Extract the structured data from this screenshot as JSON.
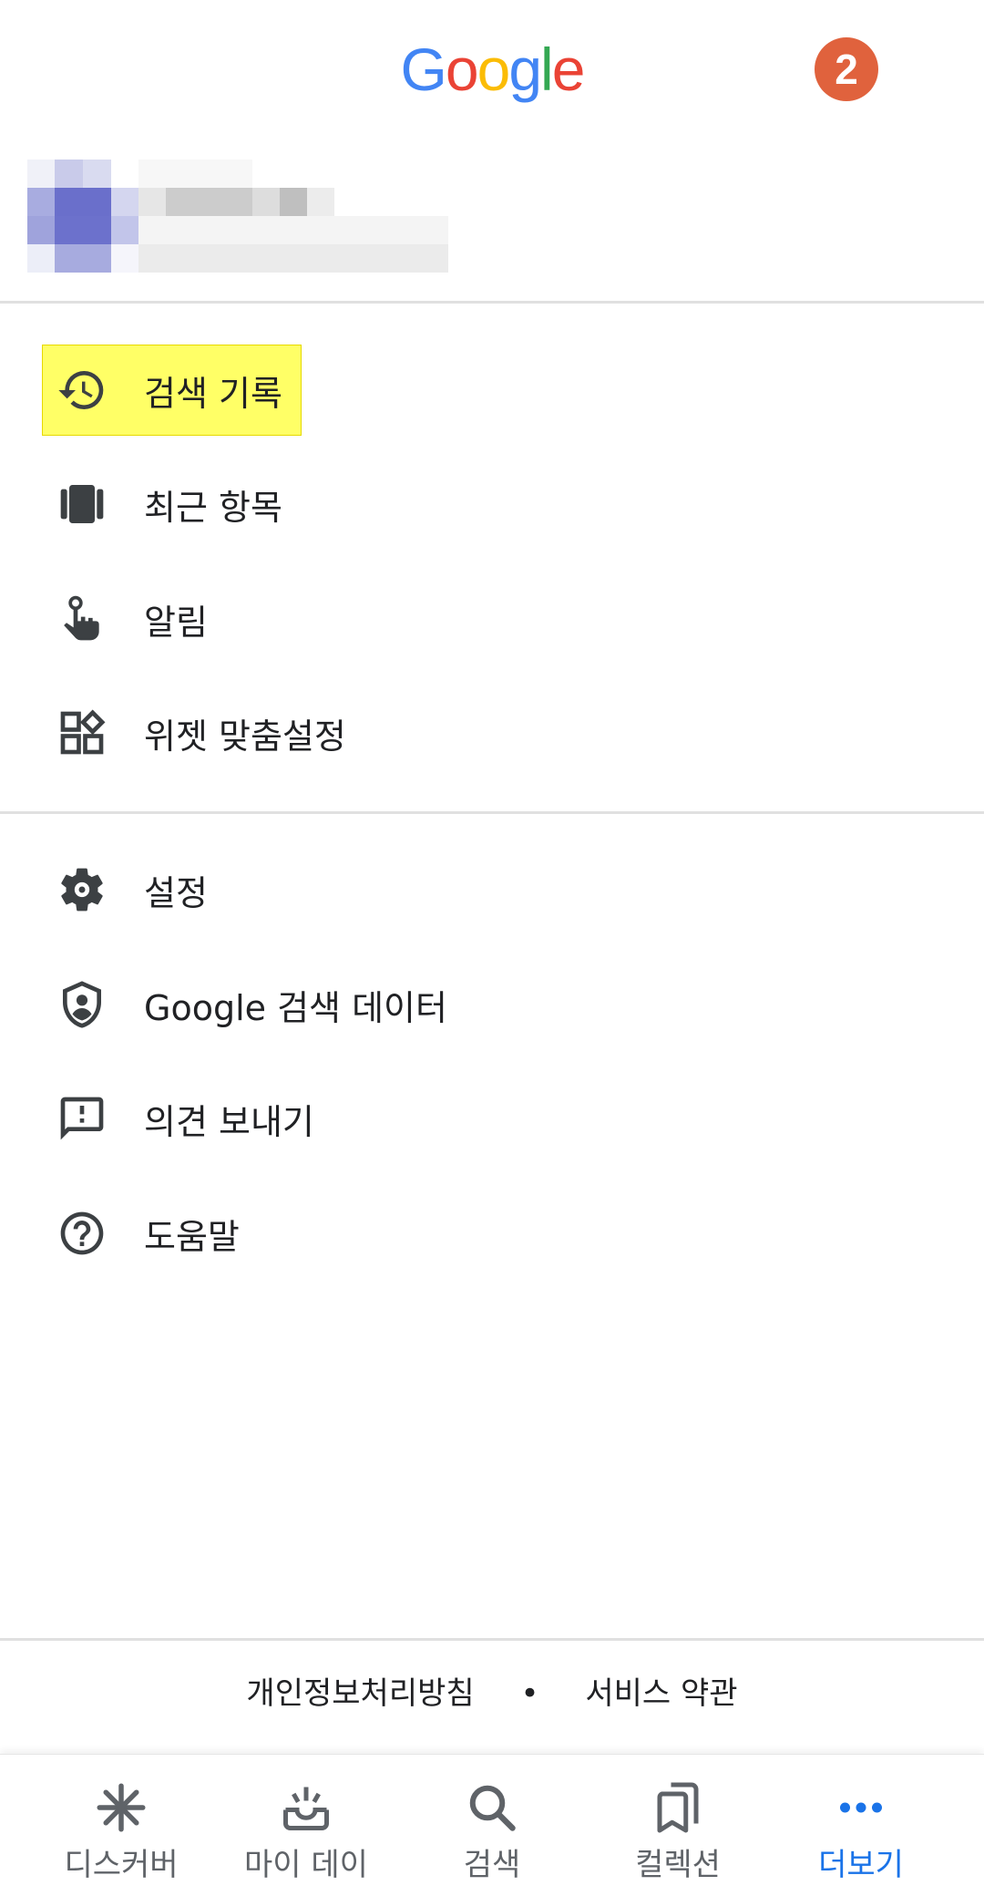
{
  "header": {
    "logo_letters": [
      "G",
      "o",
      "o",
      "g",
      "l",
      "e"
    ],
    "logo_colors": [
      "#4285F4",
      "#EA4335",
      "#FBBC05",
      "#4285F4",
      "#34A853",
      "#EA4335"
    ],
    "notification_count": "2",
    "badge_color": "#e0623d"
  },
  "menu": {
    "items": [
      {
        "label": "검색 기록",
        "icon": "history-icon",
        "highlighted": true
      },
      {
        "label": "최근 항목",
        "icon": "recent-cards-icon"
      },
      {
        "label": "알림",
        "icon": "reminder-hand-icon"
      },
      {
        "label": "위젯 맞춤설정",
        "icon": "widgets-icon"
      },
      {
        "label": "설정",
        "icon": "gear-icon"
      },
      {
        "label": "Google 검색 데이터",
        "icon": "shield-account-icon"
      },
      {
        "label": "의견 보내기",
        "icon": "feedback-icon"
      },
      {
        "label": "도움말",
        "icon": "help-circle-icon"
      }
    ],
    "highlight_color": "#ffff66"
  },
  "footer": {
    "privacy": "개인정보처리방침",
    "separator": "•",
    "terms": "서비스 약관"
  },
  "bottom_nav": {
    "items": [
      {
        "label": "디스커버",
        "icon": "asterisk-icon"
      },
      {
        "label": "마이 데이",
        "icon": "inbox-sparkle-icon"
      },
      {
        "label": "검색",
        "icon": "search-icon"
      },
      {
        "label": "컬렉션",
        "icon": "bookmarks-icon"
      },
      {
        "label": "더보기",
        "icon": "more-dots-icon",
        "active": true
      }
    ],
    "active_color": "#1a73e8",
    "inactive_color": "#5f6368"
  }
}
